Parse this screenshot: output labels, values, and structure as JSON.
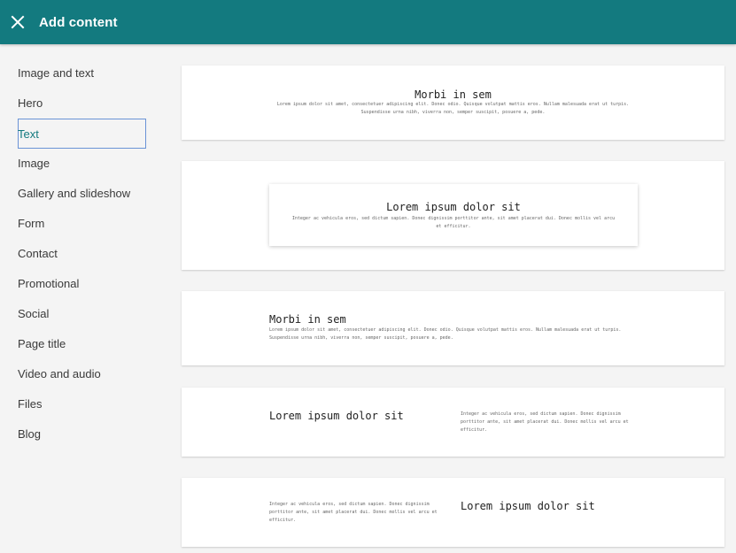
{
  "header": {
    "title": "Add content",
    "color": "#137a7f"
  },
  "sidebar": {
    "items": [
      {
        "label": "Image and text"
      },
      {
        "label": "Hero"
      },
      {
        "label": "Text",
        "selected": true
      },
      {
        "label": "Image"
      },
      {
        "label": "Gallery and slideshow"
      },
      {
        "label": "Form"
      },
      {
        "label": "Contact"
      },
      {
        "label": "Promotional"
      },
      {
        "label": "Social"
      },
      {
        "label": "Page title"
      },
      {
        "label": "Video and audio"
      },
      {
        "label": "Files"
      },
      {
        "label": "Blog"
      }
    ]
  },
  "templates": [
    {
      "heading": "Morbi in sem",
      "body_line1": "Lorem ipsum dolor sit amet, consectetuer adipiscing elit. Donec odio. Quisque volutpat mattis eros. Nullam malesuada erat ut turpis.",
      "body_line2": "Suspendisse urna nibh, viverra non, semper suscipit, posuere a, pede."
    },
    {
      "heading": "Lorem ipsum dolor sit",
      "body_line1": "Integer ac vehicula eros, sed dictum sapien. Donec dignissim porttitor ante, sit amet placerat dui. Donec mollis vel arcu",
      "body_line2": "et efficitur."
    },
    {
      "heading": "Morbi in sem",
      "body_line1": "Lorem ipsum dolor sit amet, consectetuer adipiscing elit. Donec odio. Quisque volutpat mattis eros. Nullam malesuada erat ut turpis.",
      "body_line2": "Suspendisse urna nibh, viverra non, semper suscipit, posuere a, pede."
    },
    {
      "heading": "Lorem ipsum dolor sit",
      "body_line1": "Integer ac vehicula eros, sed dictum sapien. Donec dignissim",
      "body_line2": "porttitor ante, sit amet placerat dui. Donec mollis vel arcu et",
      "body_line3": "efficitur."
    },
    {
      "heading": "Lorem ipsum dolor sit",
      "body_line1": "Integer ac vehicula eros, sed dictum sapien. Donec dignissim",
      "body_line2": "porttitor ante, sit amet placerat dui. Donec mollis vel arcu et",
      "body_line3": "efficitur."
    }
  ],
  "icons": {
    "close": "close-icon"
  }
}
